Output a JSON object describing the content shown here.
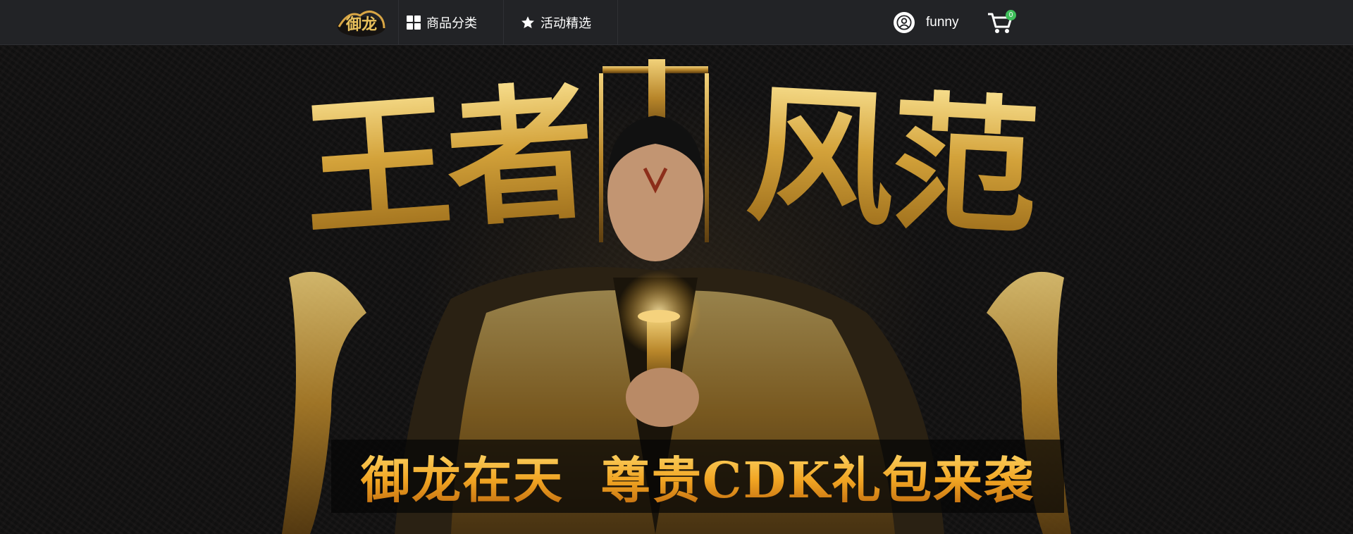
{
  "nav": {
    "logo_text": "御龙",
    "categories_label": "商品分类",
    "activities_label": "活动精选",
    "username": "funny",
    "cart_count": "0",
    "icons": {
      "categories": "grid-icon",
      "activities": "star-icon",
      "user": "user-icon",
      "cart": "cart-icon"
    }
  },
  "hero": {
    "title_left": "王者",
    "title_right": "风范",
    "slogan": "御龙在天  尊贵CDK礼包来袭"
  },
  "colors": {
    "topbar_bg": "#222326",
    "gold": "#d7a83a",
    "badge_green": "#3fbf5a"
  }
}
